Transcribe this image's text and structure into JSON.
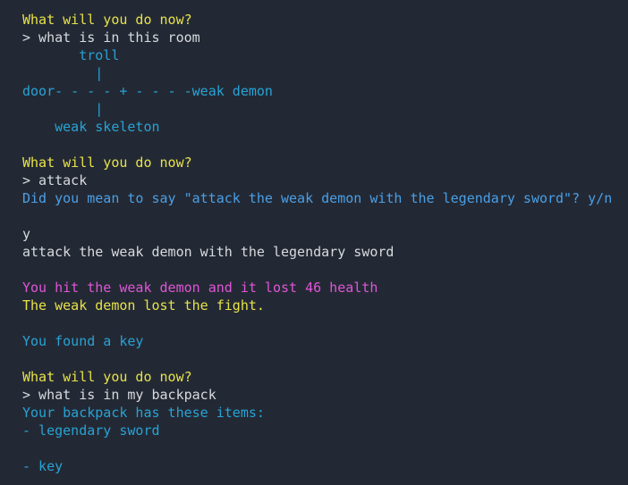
{
  "colors": {
    "background": "#232934",
    "prompt": "#e7e24a",
    "input": "#d7dade",
    "info": "#27a3d6",
    "suggestion": "#4b9fe6",
    "damage": "#e055d8"
  },
  "lines": [
    "What will you do now?",
    "> what is in this room",
    "       troll",
    "         |",
    "door- - - - + - - - -weak demon",
    "         |",
    "    weak skeleton",
    "",
    "What will you do now?",
    "> attack",
    "Did you mean to say \"attack the weak demon with the legendary sword\"? y/n",
    "",
    "y",
    "attack the weak demon with the legendary sword",
    "",
    "You hit the weak demon and it lost 46 health",
    "The weak demon lost the fight.",
    "",
    "You found a key",
    "",
    "What will you do now?",
    "> what is in my backpack",
    "Your backpack has these items:",
    "- legendary sword",
    "",
    "- key"
  ]
}
